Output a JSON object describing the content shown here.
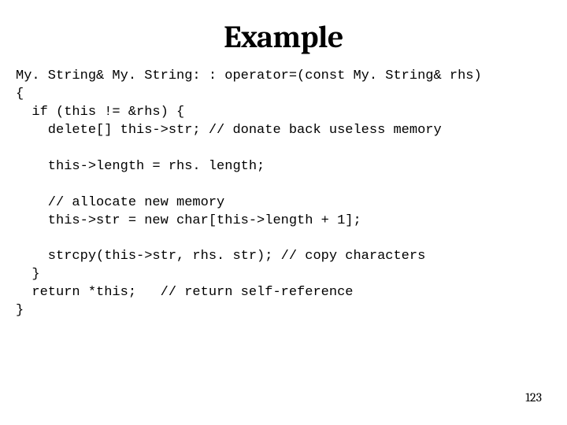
{
  "title": "Example",
  "code": {
    "l01": "My. String& My. String: : operator=(const My. String& rhs)",
    "l02": "{",
    "l03": "  if (this != &rhs) {",
    "l04": "    delete[] this->str; // donate back useless memory",
    "l05": "",
    "l06": "    this->length = rhs. length;",
    "l07": "",
    "l08": "    // allocate new memory",
    "l09": "    this->str = new char[this->length + 1];",
    "l10": "",
    "l11": "    strcpy(this->str, rhs. str); // copy characters",
    "l12": "  }",
    "l13": "  return *this;   // return self-reference",
    "l14": "}"
  },
  "page_number": "123"
}
